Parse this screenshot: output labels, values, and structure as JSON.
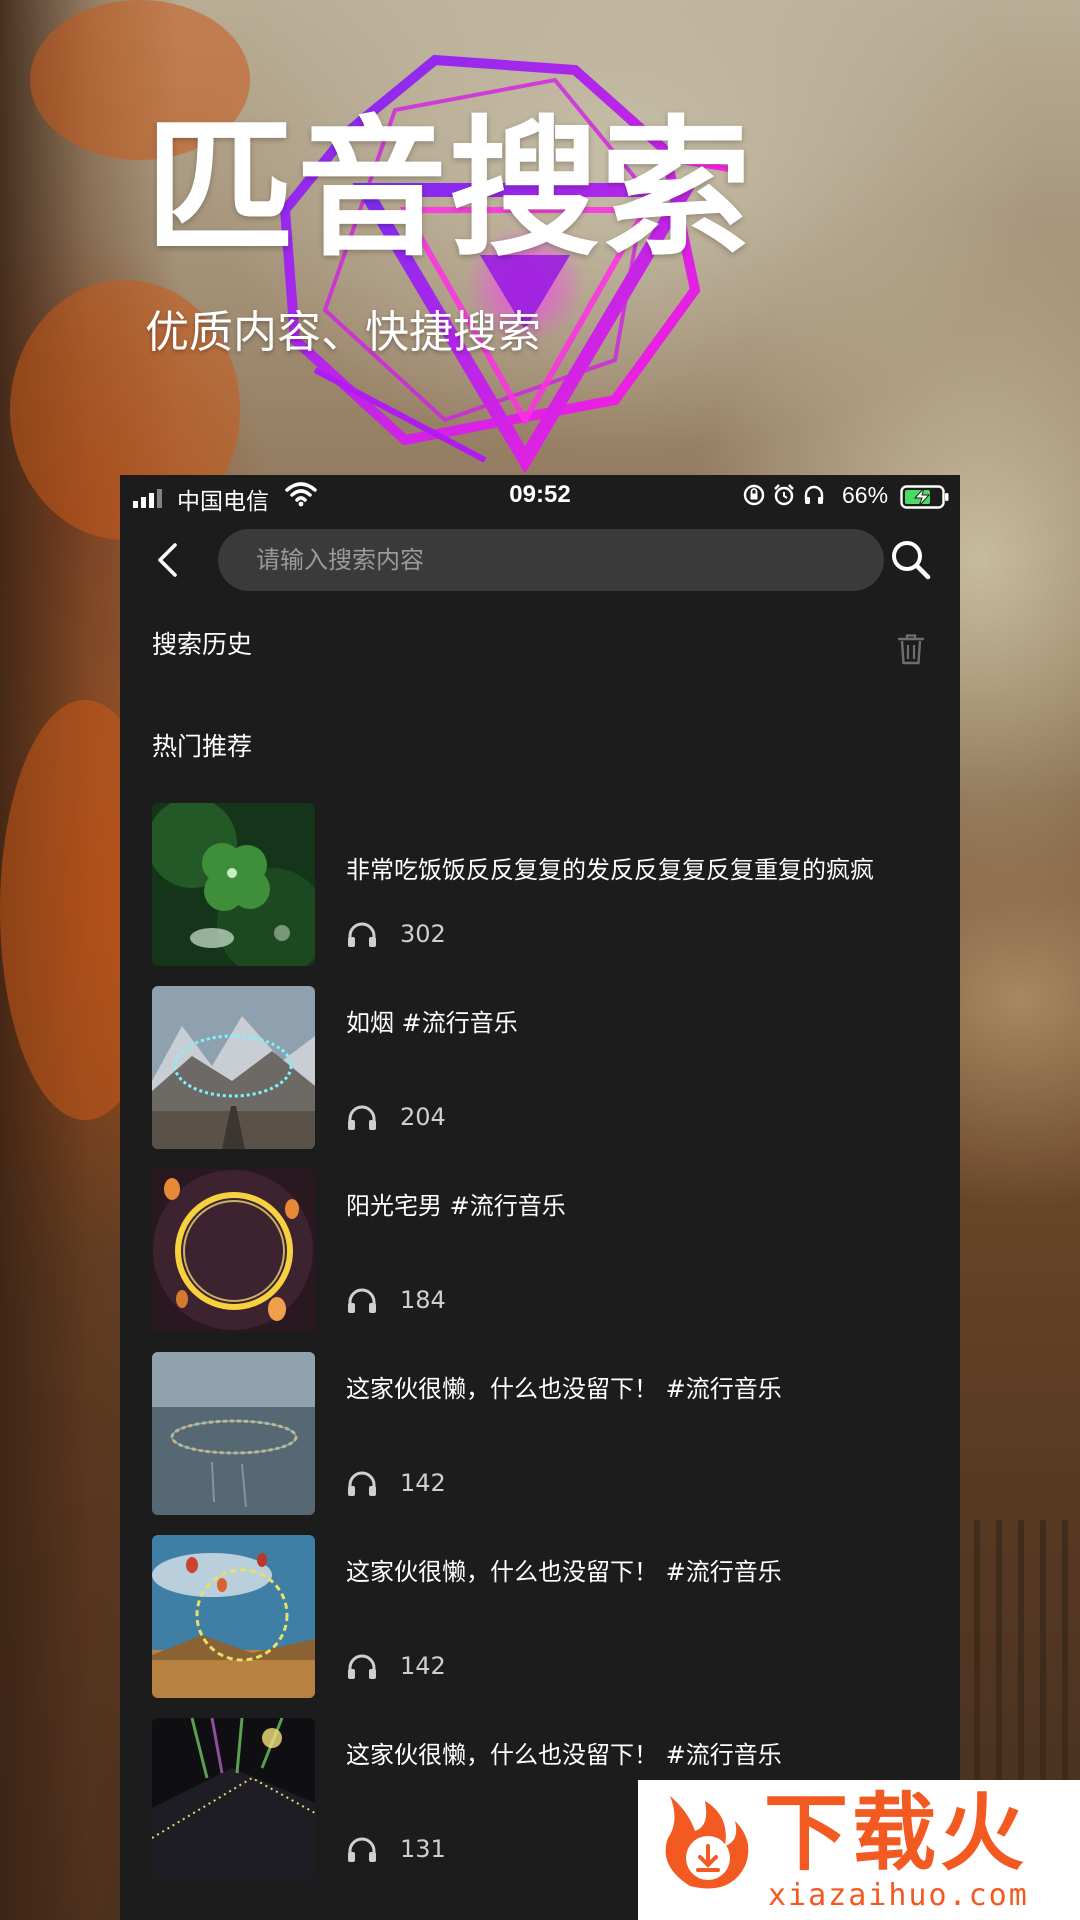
{
  "hero": {
    "title": "匹音搜索",
    "subtitle": "优质内容、快捷搜索"
  },
  "status_bar": {
    "carrier": "中国电信",
    "time": "09:52",
    "battery_percent": "66%",
    "icons": [
      "signal-icon",
      "wifi-icon",
      "screen-lock-icon",
      "alarm-icon",
      "headphones-icon",
      "battery-charging-icon"
    ]
  },
  "nav": {
    "back_icon": "chevron-left-icon",
    "search_placeholder": "请输入搜索内容",
    "search_value": "",
    "search_icon": "search-icon"
  },
  "history": {
    "label": "搜索历史",
    "clear_icon": "trash-icon"
  },
  "hot": {
    "label": "热门推荐",
    "items": [
      {
        "title": "非常吃饭饭反反复复的发反反复复反复重复的疯疯",
        "plays": "302"
      },
      {
        "title": "如烟 #流行音乐",
        "plays": "204"
      },
      {
        "title": "阳光宅男 #流行音乐",
        "plays": "184"
      },
      {
        "title": "这家伙很懒，什么也没留下！ #流行音乐",
        "plays": "142"
      },
      {
        "title": "这家伙很懒，什么也没留下！ #流行音乐",
        "plays": "142"
      },
      {
        "title": "这家伙很懒，什么也没留下！ #流行音乐",
        "plays": "131"
      }
    ]
  },
  "watermark": {
    "name": "下载火",
    "url": "xiazaihuo.com"
  },
  "colors": {
    "screen_bg": "#1c1c1c",
    "search_bg": "#3a3a3a",
    "accent_neon": "#c21ee8",
    "watermark_orange": "#f25a21"
  }
}
